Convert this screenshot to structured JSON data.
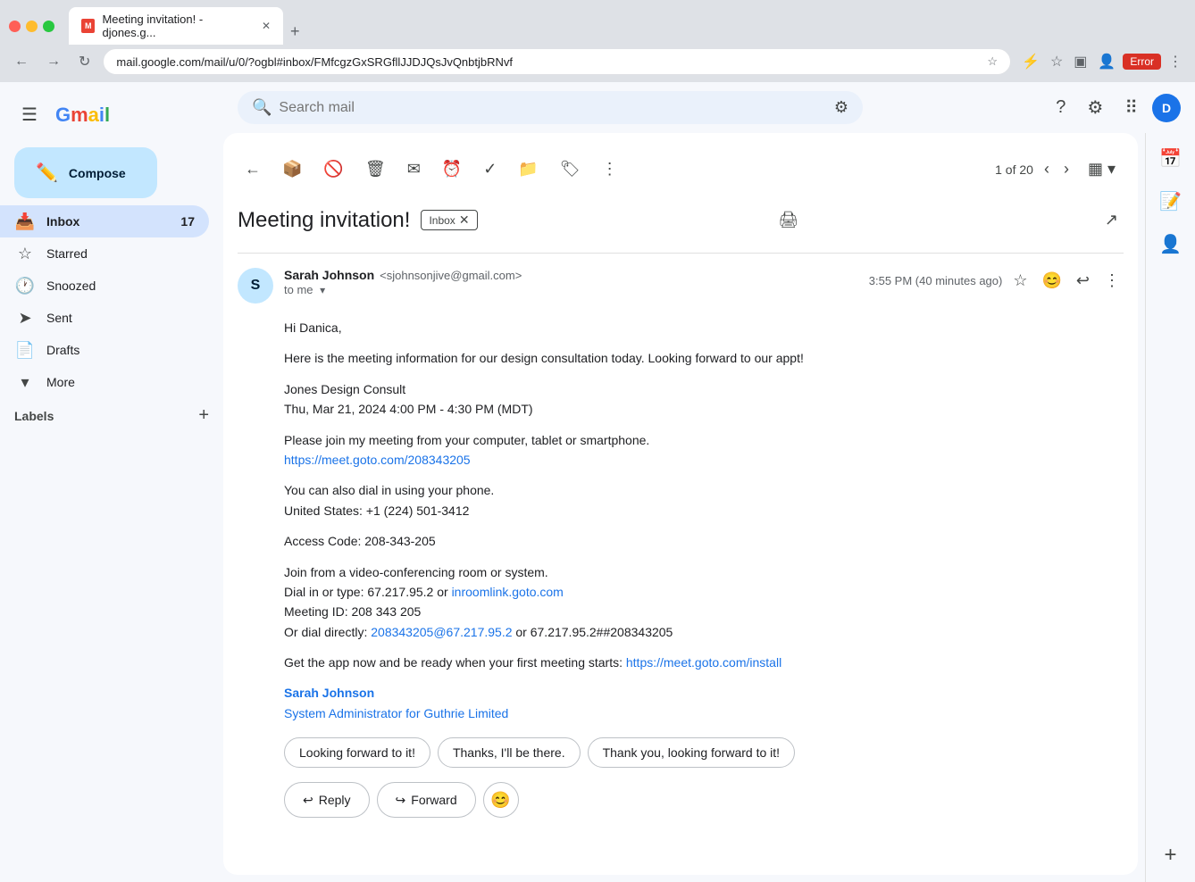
{
  "browser": {
    "tab_favicon": "M",
    "tab_title": "Meeting invitation! - djones.g...",
    "address": "mail.google.com/mail/u/0/?ogbl#inbox/FMfcgzGxSRGfllJJDJQsJvQnbtjbRNvf",
    "error_label": "Error"
  },
  "gmail": {
    "logo_text": "Gmail",
    "search_placeholder": "Search mail"
  },
  "sidebar": {
    "compose_label": "Compose",
    "nav_items": [
      {
        "id": "inbox",
        "icon": "📥",
        "label": "Inbox",
        "badge": "17",
        "active": true
      },
      {
        "id": "starred",
        "icon": "☆",
        "label": "Starred",
        "badge": ""
      },
      {
        "id": "snoozed",
        "icon": "🕐",
        "label": "Snoozed",
        "badge": ""
      },
      {
        "id": "sent",
        "icon": "➤",
        "label": "Sent",
        "badge": ""
      },
      {
        "id": "drafts",
        "icon": "📄",
        "label": "Drafts",
        "badge": ""
      },
      {
        "id": "more",
        "icon": "▾",
        "label": "More",
        "badge": ""
      }
    ],
    "labels_title": "Labels",
    "labels_add_icon": "+"
  },
  "toolbar": {
    "back_icon": "←",
    "archive_icon": "📦",
    "report_icon": "🚫",
    "delete_icon": "🗑",
    "mark_icon": "✉",
    "snooze_icon": "⏰",
    "task_icon": "✓",
    "move_icon": "📁",
    "label_icon": "🏷",
    "more_icon": "⋮",
    "pagination_text": "1 of 20",
    "prev_icon": "‹",
    "next_icon": "›",
    "view_icon": "▦"
  },
  "email": {
    "subject": "Meeting invitation!",
    "inbox_badge": "Inbox",
    "print_icon": "🖨",
    "newwindow_icon": "↗",
    "sender_name": "Sarah Johnson",
    "sender_email": "<sjohnsonjive@gmail.com>",
    "to_me": "to me",
    "time": "3:55 PM (40 minutes ago)",
    "star_icon": "☆",
    "emoji_icon": "😊",
    "reply_icon": "↩",
    "more_icon": "⋮",
    "body_lines": [
      "Hi Danica,",
      "",
      "Here is the meeting information for our design consultation today. Looking forward to our appt!",
      "",
      "Jones Design Consult",
      "Thu, Mar 21, 2024 4:00 PM - 4:30 PM (MDT)",
      "",
      "Please join my meeting from your computer, tablet or smartphone.",
      "",
      "You can also dial in using your phone.",
      "United States: +1 (224) 501-3412",
      "",
      "Access Code: 208-343-205",
      "",
      "Join from a video-conferencing room or system.",
      "Dial in or type: 67.217.95.2 or",
      "Meeting ID: 208 343 205",
      "Or dial directly:",
      "",
      "Get the app now and be ready when your first meeting starts:",
      "",
      "Sarah Johnson",
      "System Administrator for Guthrie Limited"
    ],
    "meet_link": "https://meet.goto.com/208343205",
    "inroomlink": "inroomlink.goto.com",
    "dial_direct": "208343205@67.217.95.2",
    "install_link": "https://meet.goto.com/install",
    "smart_replies": [
      "Looking forward to it!",
      "Thanks, I'll be there.",
      "Thank you, looking forward to it!"
    ],
    "reply_label": "Reply",
    "forward_label": "Forward",
    "emoji_btn_icon": "😊"
  },
  "right_sidebar": {
    "icons": [
      "📅",
      "📝",
      "👤"
    ],
    "add_icon": "+"
  }
}
